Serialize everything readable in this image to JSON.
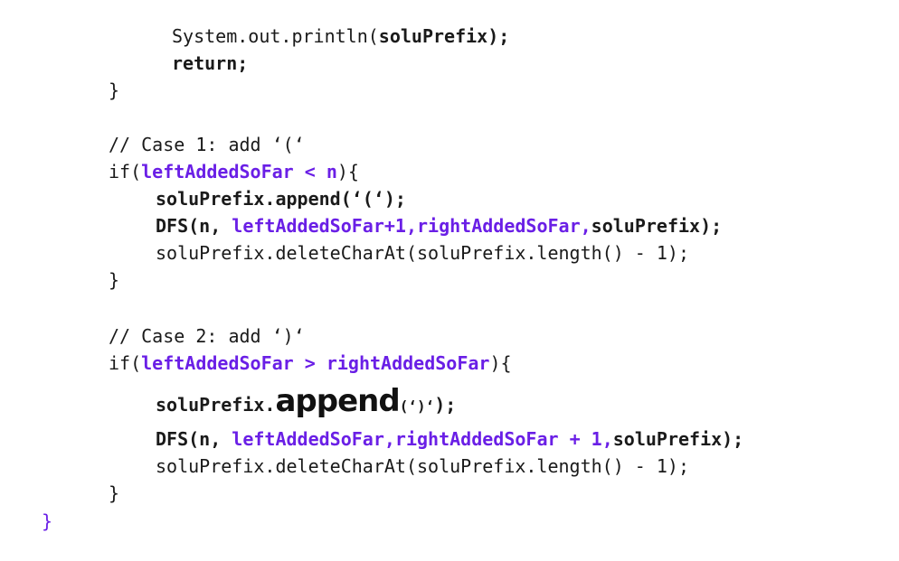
{
  "code": {
    "l1_pre": "System.out.println(",
    "l1_arg": "soluPrefix",
    "l1_post": ");",
    "l2": "return;",
    "l3": "}",
    "c1_comment": "// Case 1: add ‘(‘",
    "c1_if_pre": "if(",
    "c1_cond": "leftAddedSoFar < n",
    "c1_if_post": "){",
    "c1_append_obj": "soluPrefix.append(",
    "c1_append_arg": "‘(‘",
    "c1_append_end": ");",
    "c1_dfs_pre": "DFS(n, ",
    "c1_dfs_args": "leftAddedSoFar+1,rightAddedSoFar,",
    "c1_dfs_post": "soluPrefix);",
    "c1_delete": "soluPrefix.deleteCharAt(soluPrefix.length() - 1);",
    "c1_close": "}",
    "c2_comment": "// Case 2: add ‘)‘",
    "c2_if_pre": "if(",
    "c2_cond": "leftAddedSoFar > rightAddedSoFar",
    "c2_if_post": "){",
    "c2_append_obj": "soluPrefix.",
    "c2_append_method": "append",
    "c2_append_arg": "(‘)‘",
    "c2_append_end": ");",
    "c2_dfs_pre": "DFS(n, ",
    "c2_dfs_args": "leftAddedSoFar,rightAddedSoFar + 1,",
    "c2_dfs_post": "soluPrefix);",
    "c2_delete": "soluPrefix.deleteCharAt(soluPrefix.length() - 1);",
    "c2_close": "}",
    "final_close": "}"
  },
  "colors": {
    "keyword_purple": "#6a1fe6",
    "text": "#1a1a1a"
  }
}
